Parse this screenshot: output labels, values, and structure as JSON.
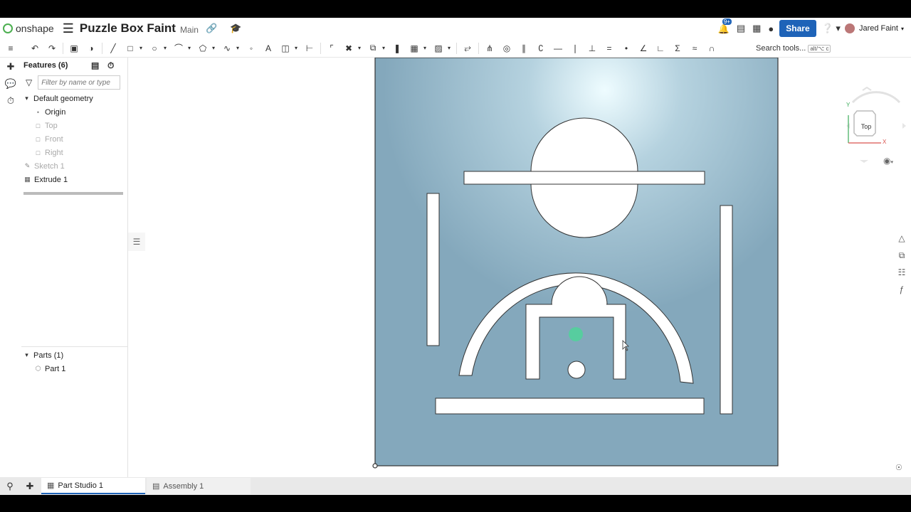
{
  "header": {
    "app_name": "onshape",
    "doc_title": "Puzzle Box Faint",
    "branch": "Main",
    "notification_count": "9+",
    "share_label": "Share",
    "user_name": "Jared Faint"
  },
  "toolbar": {
    "search_label": "Search tools...",
    "search_shortcut": "alt/⌥ c"
  },
  "features": {
    "title": "Features (6)",
    "filter_placeholder": "Filter by name or type",
    "default_geometry": "Default geometry",
    "items": [
      {
        "label": "Origin",
        "dim": false
      },
      {
        "label": "Top",
        "dim": true
      },
      {
        "label": "Front",
        "dim": true
      },
      {
        "label": "Right",
        "dim": true
      },
      {
        "label": "Sketch 1",
        "dim": true
      },
      {
        "label": "Extrude 1",
        "dim": false
      }
    ]
  },
  "parts": {
    "title": "Parts (1)",
    "items": [
      "Part 1"
    ]
  },
  "viewcube": {
    "face_label": "Top",
    "axis_x": "X",
    "axis_y": "Y"
  },
  "tabs": {
    "items": [
      "Part Studio 1",
      "Assembly 1"
    ]
  },
  "colors": {
    "accent": "#1e63b8",
    "part_fill": "#87a9bd",
    "indicator": "#4fd49a"
  },
  "icons": {
    "undo": "undo-icon",
    "redo": "redo-icon",
    "sketch": "sketch-icon",
    "line": "line-icon",
    "rectangle": "rectangle-icon",
    "circle": "circle-icon",
    "arc": "arc-icon",
    "polygon": "polygon-icon",
    "spline": "spline-icon",
    "point": "point-icon",
    "text": "text-icon",
    "filter": "funnel-icon"
  }
}
